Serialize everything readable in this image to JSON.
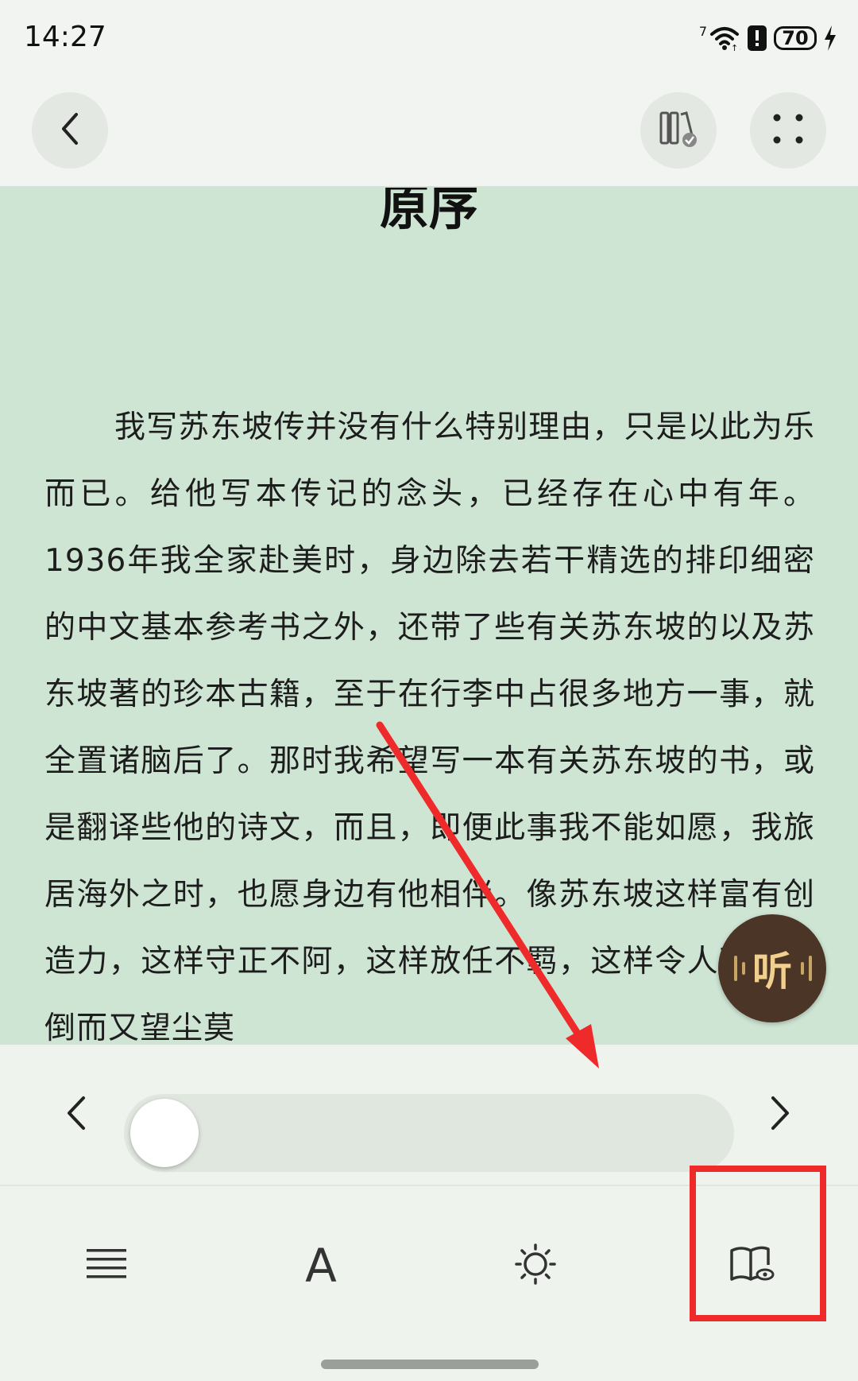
{
  "status_bar": {
    "time": "14:27",
    "signal_superscript": "7",
    "battery_level": "70",
    "icons": [
      "wifi-icon",
      "alert-icon",
      "battery-icon",
      "charging-bolt-icon"
    ]
  },
  "toolbar": {
    "icons": [
      "back-chevron-icon",
      "bookshelf-icon",
      "more-dots-icon"
    ]
  },
  "chapter": {
    "title": "原序",
    "text": "我写苏东坡传并没有什么特别理由，只是以此为乐而已。给他写本传记的念头，已经存在心中有年。1936年我全家赴美时，身边除去若干精选的排印细密的中文基本参考书之外，还带了些有关苏东坡的以及苏东坡著的珍本古籍，至于在行李中占很多地方一事，就全置诸脑后了。那时我希望写一本有关苏东坡的书，或是翻译些他的诗文，而且，即便此事我不能如愿，我旅居海外之时，也愿身边有他相伴。像苏东坡这样富有创造力，这样守正不阿，这样放任不羁，这样令人万分倾倒而又望尘莫"
  },
  "listen_button": {
    "label": "听"
  },
  "progress": {
    "fraction": 0.0,
    "icons": [
      "prev-chapter-icon",
      "next-chapter-icon"
    ]
  },
  "bottom_nav": {
    "font_label": "A",
    "icons": [
      "menu-list-icon",
      "font-icon",
      "brightness-icon",
      "reading-mode-icon"
    ]
  },
  "colors": {
    "page_background": "#cfe5d4",
    "chrome_background": "#f1f4f0",
    "listen_button": "#4a3526",
    "listen_label": "#f1cf8e",
    "annotation": "#ee2a2a"
  }
}
